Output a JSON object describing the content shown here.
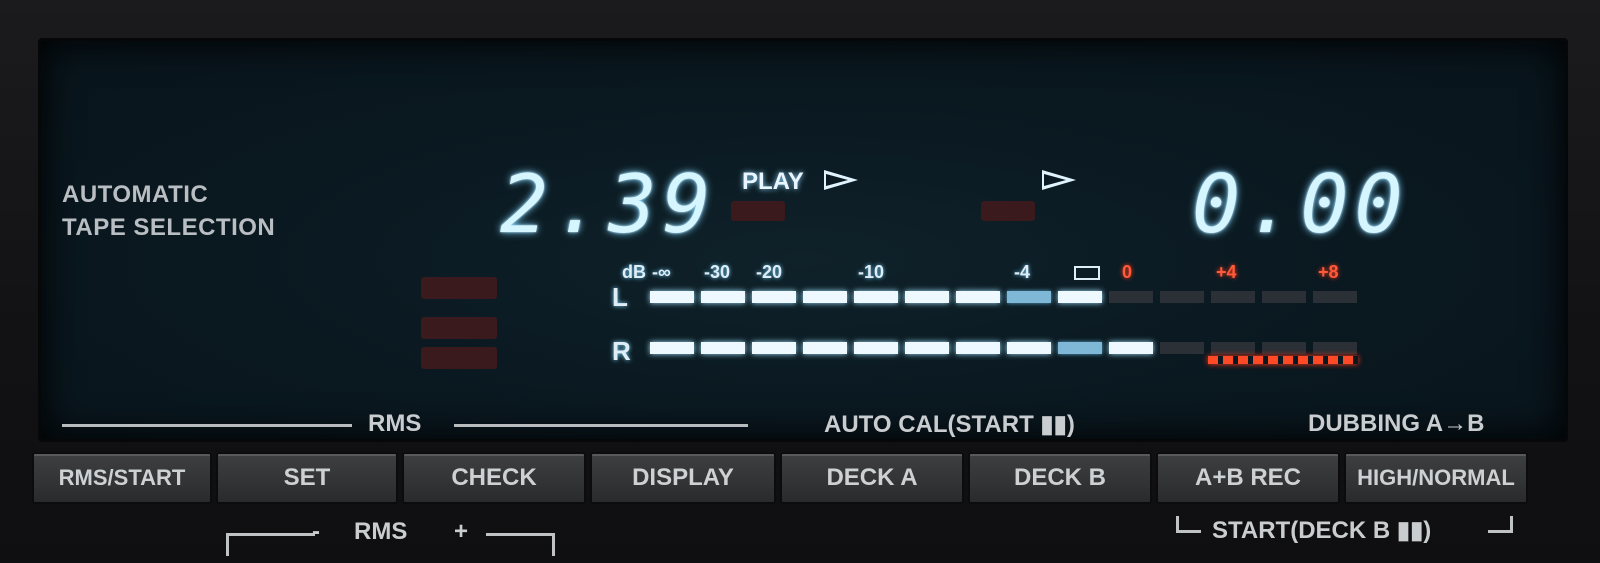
{
  "panel": {
    "label_line1": "AUTOMATIC",
    "label_line2": "TAPE SELECTION"
  },
  "deck_a": {
    "counter": "2.39",
    "status": "PLAY"
  },
  "deck_b": {
    "counter": "0.00"
  },
  "meter": {
    "scale_labels": [
      "dB",
      "-∞",
      "-30",
      "-20",
      "-10",
      "-4",
      "0",
      "+4",
      "+8"
    ],
    "channel_left": "L",
    "channel_right": "R",
    "left_level_segments_lit": 9,
    "right_level_segments_lit": 10
  },
  "sections": {
    "rms": "RMS",
    "auto_cal": "AUTO CAL(START ▮▮)",
    "dubbing": "DUBBING A→B",
    "rms_adjust": "RMS",
    "rms_minus": "-",
    "rms_plus": "+",
    "start_deck_b": "START(DECK B ▮▮)"
  },
  "buttons": {
    "rms_start": "RMS/START",
    "set": "SET",
    "check": "CHECK",
    "display": "DISPLAY",
    "deck_a": "DECK A",
    "deck_b": "DECK B",
    "ab_rec": "A+B REC",
    "high_normal": "HIGH/NORMAL"
  },
  "colors": {
    "vfd_blue": "#d6f6ff",
    "vfd_red": "#ff5a3a",
    "panel": "#141416"
  }
}
